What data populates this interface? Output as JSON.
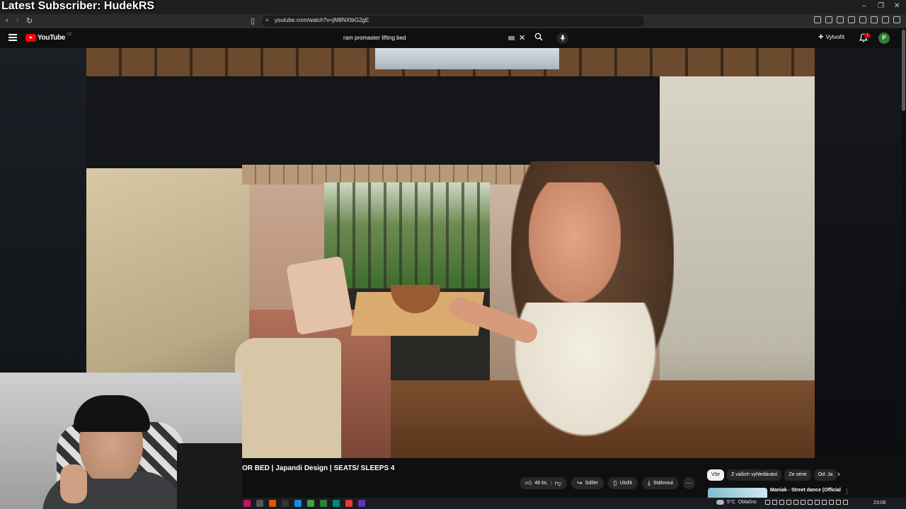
{
  "overlay": {
    "title": "Latest Subscriber: HudekRS"
  },
  "browser": {
    "url": "youtube.com/watch?v=jM8NXtbG2gE",
    "window_controls": {
      "minimize": "–",
      "restore": "❐",
      "close": "✕"
    }
  },
  "masthead": {
    "logo_text": "YouTube",
    "logo_country": "CZ",
    "search_query": "ram promaster lifting bed",
    "create_label": "Vytvořit",
    "notification_count": "1",
    "avatar_letter": "P"
  },
  "video": {
    "title": "OR BED | Japandi Design | SEATS/ SLEEPS 4",
    "actions": {
      "likes": "46 tis.",
      "share": "Sdílet",
      "save": "Uložit",
      "download": "Stáhnout"
    }
  },
  "sidebar_chips": [
    "Vše",
    "Z vašich vyhledávání",
    "Ze série",
    "Od: Ja"
  ],
  "recommendation": {
    "title": "Maniak - Street dance (Official"
  },
  "taskbar": {
    "weather": "5°C",
    "weather_desc": "Oblačno",
    "time": "23:06"
  },
  "colors": {
    "yt_red": "#ff0000",
    "chip_active": "#f1f1f1",
    "avatar_bg": "#2e7d32"
  }
}
